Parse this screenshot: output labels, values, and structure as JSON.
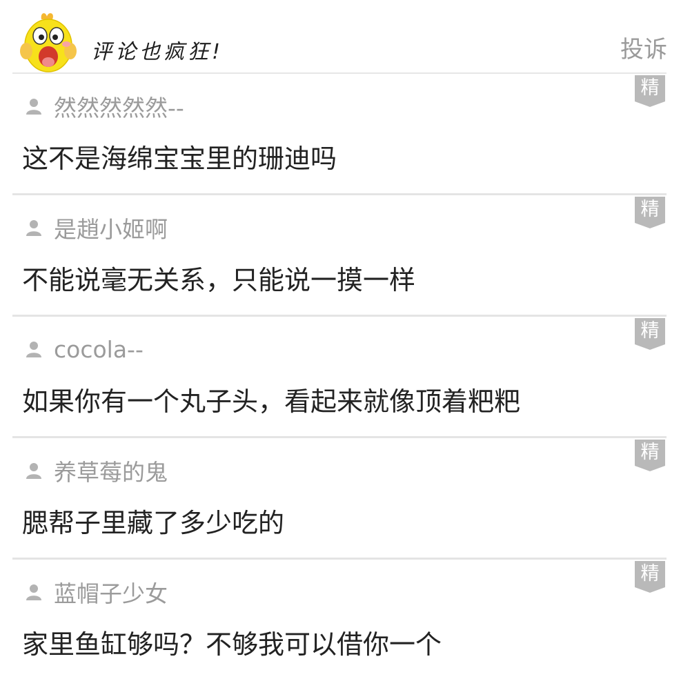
{
  "header": {
    "title": "评论也疯狂!",
    "report_label": "投诉",
    "mascot_icon": "yellow-duck-mascot"
  },
  "colors": {
    "badge_bg": "#b9b9b9",
    "username": "#9b9b9b",
    "divider": "#e4e4e4",
    "mascot_yellow": "#f7e11b"
  },
  "comments": [
    {
      "user": "然然然然然--",
      "text": "这不是海绵宝宝里的珊迪吗",
      "badge": "精"
    },
    {
      "user": "是趙小姬啊",
      "text": "不能说毫无关系，只能说一摸一样",
      "badge": "精"
    },
    {
      "user": "cocola--",
      "text": "如果你有一个丸子头，看起来就像顶着粑粑",
      "badge": "精"
    },
    {
      "user": "养草莓的鬼",
      "text": "腮帮子里藏了多少吃的",
      "badge": "精"
    },
    {
      "user": "蓝帽子少女",
      "text": "家里鱼缸够吗？不够我可以借你一个",
      "badge": "精"
    }
  ]
}
